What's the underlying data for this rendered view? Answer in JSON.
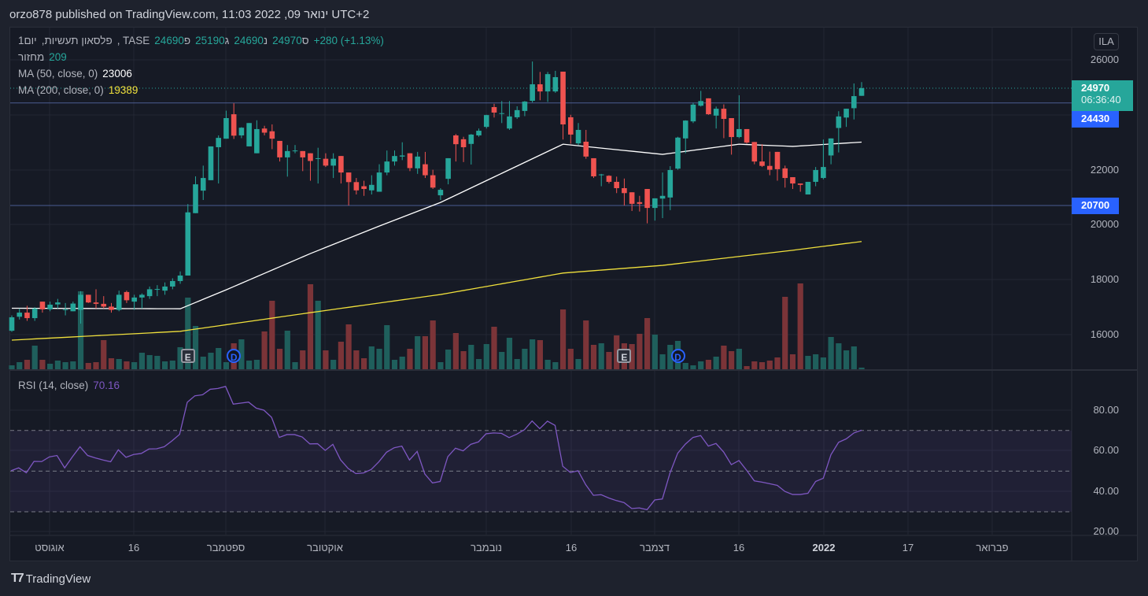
{
  "header": {
    "title": "orzo878 published on TradingView.com, ינואר 09, 2022 11:03 UTC+2"
  },
  "legend": {
    "interval": "1יום",
    "symbol": ",פלסאון תעשיות",
    "exchange": ", TASE",
    "open_label": "פ",
    "open": "24690",
    "high_label": "ג",
    "high": "25190",
    "low_label": "נ",
    "low": "24690",
    "close_label": "ס",
    "close": "24970",
    "change": "+280 (+1.13%)",
    "volume_label": "מחזור",
    "volume": "209",
    "ma50_label": "MA (50, close, 0)",
    "ma50": "23006",
    "ma200_label": "MA (200, close, 0)",
    "ma200": "19389",
    "rsi_label": "RSI (14, close)",
    "rsi": "70.16"
  },
  "price_scale": {
    "currency": "ILA",
    "ticks": [
      "26000",
      "22000",
      "20000",
      "18000",
      "16000"
    ],
    "last_price": "24970",
    "countdown": "06:36:40",
    "level_1": "24430",
    "level_2": "20700"
  },
  "rsi_scale": {
    "ticks": [
      "80.00",
      "60.00",
      "40.00",
      "20.00"
    ]
  },
  "time_axis": [
    "אוגוסט",
    "16",
    "ספטמבר",
    "אוקטובר",
    "נובמבר",
    "16",
    "דצמבר",
    "16",
    "2022",
    "17",
    "פברואר"
  ],
  "events": [
    {
      "type": "E",
      "index": 23
    },
    {
      "type": "D",
      "index": 29
    },
    {
      "type": "E",
      "index": 80
    },
    {
      "type": "D",
      "index": 87
    }
  ],
  "branding": "TradingView",
  "colors": {
    "up": "#26a69a",
    "down": "#ef5350",
    "ma50": "#ffffff",
    "ma200": "#f0e03c",
    "rsi": "#7e57c2",
    "level": "#2962ff"
  },
  "chart_data": {
    "type": "candlestick",
    "ylim": [
      15000,
      26500
    ],
    "horizontal_levels": [
      24430,
      20700
    ],
    "candles_ohlc": [
      [
        16140,
        16700,
        16100,
        16630
      ],
      [
        16650,
        16950,
        16550,
        16800
      ],
      [
        16800,
        17050,
        16500,
        16600
      ],
      [
        16600,
        17000,
        16500,
        16950
      ],
      [
        17200,
        17200,
        16800,
        16920
      ],
      [
        16920,
        17200,
        16850,
        17090
      ],
      [
        17100,
        17300,
        16950,
        17170
      ],
      [
        16900,
        17150,
        16700,
        16920
      ],
      [
        16850,
        17200,
        16850,
        17130
      ],
      [
        16900,
        17580,
        16400,
        17450
      ],
      [
        17450,
        17450,
        17150,
        17170
      ],
      [
        17170,
        17650,
        16950,
        17120
      ],
      [
        17120,
        17400,
        16950,
        17020
      ],
      [
        17020,
        17150,
        16800,
        16900
      ],
      [
        16900,
        17600,
        16850,
        17450
      ],
      [
        17550,
        17600,
        17150,
        17250
      ],
      [
        17200,
        17450,
        16900,
        17350
      ],
      [
        17350,
        17500,
        16950,
        17450
      ],
      [
        17400,
        17750,
        17300,
        17650
      ],
      [
        17650,
        17800,
        17400,
        17660
      ],
      [
        17600,
        17900,
        17450,
        17750
      ],
      [
        17750,
        18050,
        17650,
        17950
      ],
      [
        17950,
        18300,
        17850,
        18150
      ],
      [
        18150,
        20750,
        18150,
        20450
      ],
      [
        20420,
        21760,
        20420,
        21470
      ],
      [
        21240,
        22150,
        20900,
        21700
      ],
      [
        21620,
        22850,
        21620,
        22850
      ],
      [
        22820,
        23250,
        21500,
        23160
      ],
      [
        23130,
        24150,
        23130,
        23880
      ],
      [
        24020,
        24420,
        23120,
        23240
      ],
      [
        23250,
        23550,
        23150,
        23530
      ],
      [
        22850,
        23700,
        22850,
        23700
      ],
      [
        22600,
        23800,
        22600,
        23480
      ],
      [
        23500,
        23600,
        23250,
        23350
      ],
      [
        23400,
        23650,
        22750,
        23130
      ],
      [
        23050,
        23050,
        22300,
        22450
      ],
      [
        22450,
        22900,
        21750,
        22680
      ],
      [
        22680,
        22900,
        22600,
        22700
      ],
      [
        22680,
        22680,
        21950,
        22450
      ],
      [
        22600,
        22600,
        21600,
        22320
      ],
      [
        22400,
        22800,
        21500,
        22420
      ],
      [
        22400,
        22600,
        22100,
        22150
      ],
      [
        22150,
        22600,
        21700,
        22400
      ],
      [
        22500,
        22500,
        21500,
        21900
      ],
      [
        21900,
        21900,
        20700,
        21550
      ],
      [
        21550,
        21700,
        21100,
        21250
      ],
      [
        21400,
        21600,
        21050,
        21300
      ],
      [
        21250,
        21800,
        21100,
        21450
      ],
      [
        21200,
        22200,
        21200,
        21900
      ],
      [
        21900,
        22700,
        21800,
        22300
      ],
      [
        22300,
        22700,
        22150,
        22500
      ],
      [
        22480,
        23000,
        22350,
        22520
      ],
      [
        22600,
        22600,
        21950,
        22060
      ],
      [
        22050,
        22650,
        21850,
        22480
      ],
      [
        22200,
        22650,
        21700,
        21800
      ],
      [
        21800,
        22000,
        21300,
        21350
      ],
      [
        21070,
        21330,
        20900,
        21270
      ],
      [
        21670,
        22420,
        21470,
        22420
      ],
      [
        23250,
        23300,
        22300,
        22930
      ],
      [
        23110,
        23200,
        22280,
        22820
      ],
      [
        22940,
        23300,
        22190,
        23280
      ],
      [
        23250,
        23500,
        23200,
        23420
      ],
      [
        23560,
        24000,
        23500,
        23990
      ],
      [
        24280,
        24400,
        23900,
        24080
      ],
      [
        24050,
        24500,
        23700,
        24060
      ],
      [
        23500,
        24500,
        23450,
        23940
      ],
      [
        23910,
        24310,
        23850,
        24170
      ],
      [
        24140,
        24500,
        23950,
        24480
      ],
      [
        24510,
        25940,
        24450,
        25110
      ],
      [
        25110,
        25560,
        24530,
        24850
      ],
      [
        24850,
        25560,
        24470,
        25480
      ],
      [
        24850,
        25600,
        24800,
        25370
      ],
      [
        25570,
        25570,
        23100,
        23650
      ],
      [
        23910,
        24000,
        22950,
        23280
      ],
      [
        22960,
        23700,
        22900,
        23450
      ],
      [
        23020,
        23450,
        22400,
        22480
      ],
      [
        22420,
        22420,
        21700,
        21760
      ],
      [
        21800,
        21850,
        21400,
        21830
      ],
      [
        21780,
        21800,
        21500,
        21560
      ],
      [
        21560,
        21750,
        21150,
        21330
      ],
      [
        21330,
        21680,
        20700,
        21150
      ],
      [
        21180,
        21180,
        20500,
        20760
      ],
      [
        20820,
        21050,
        20480,
        20760
      ],
      [
        21300,
        21300,
        20050,
        20610
      ],
      [
        20610,
        20960,
        20150,
        20960
      ],
      [
        20950,
        21900,
        20240,
        21050
      ],
      [
        20990,
        22130,
        20530,
        21990
      ],
      [
        22040,
        23200,
        22000,
        23170
      ],
      [
        23140,
        23800,
        22600,
        23790
      ],
      [
        23760,
        24440,
        23700,
        24370
      ],
      [
        24330,
        24870,
        24300,
        24500
      ],
      [
        24600,
        24600,
        24000,
        24020
      ],
      [
        23970,
        24300,
        23500,
        24220
      ],
      [
        24220,
        24380,
        23150,
        23850
      ],
      [
        23880,
        23880,
        22550,
        23190
      ],
      [
        23190,
        24710,
        23150,
        23480
      ],
      [
        23480,
        23480,
        22950,
        22990
      ],
      [
        23010,
        23010,
        22200,
        22300
      ],
      [
        22300,
        22930,
        22100,
        22140
      ],
      [
        22140,
        22660,
        21800,
        22000
      ],
      [
        22650,
        22650,
        21600,
        22020
      ],
      [
        22050,
        22150,
        21350,
        21700
      ],
      [
        21730,
        21730,
        21300,
        21500
      ],
      [
        21500,
        21500,
        21200,
        21450
      ],
      [
        21100,
        21560,
        21100,
        21560
      ],
      [
        21560,
        22100,
        21400,
        21990
      ],
      [
        21700,
        23100,
        21650,
        22100
      ],
      [
        22520,
        23140,
        22200,
        23140
      ],
      [
        23520,
        24130,
        22630,
        23940
      ],
      [
        23900,
        24220,
        23560,
        24220
      ],
      [
        24240,
        25140,
        23830,
        24680
      ],
      [
        24690,
        25190,
        24690,
        24970
      ]
    ],
    "volume": [
      500,
      900,
      1200,
      3000,
      1200,
      700,
      1100,
      900,
      1000,
      9900,
      800,
      900,
      3700,
      1400,
      1300,
      1000,
      900,
      2100,
      1800,
      1700,
      1000,
      1100,
      2800,
      9100,
      5500,
      1600,
      2100,
      2700,
      900,
      3300,
      3800,
      1100,
      1200,
      4800,
      8700,
      2600,
      4900,
      900,
      2400,
      10800,
      8700,
      2400,
      1200,
      3500,
      5700,
      2400,
      1400,
      2900,
      2600,
      5600,
      1200,
      1600,
      2600,
      4200,
      4200,
      6200,
      900,
      2500,
      4600,
      2300,
      3100,
      1300,
      3200,
      5400,
      2200,
      4000,
      1300,
      2600,
      3800,
      3700,
      1200,
      900,
      7600,
      2600,
      1300,
      6200,
      3100,
      3300,
      2200,
      4300,
      3300,
      3200,
      4500,
      6500,
      4400,
      1900,
      3100,
      3600,
      800,
      500,
      1000,
      1200,
      1600,
      3000,
      2300,
      2600,
      400,
      1000,
      900,
      1100,
      1500,
      9200,
      1900,
      10900,
      1700,
      1900,
      1500,
      4100,
      3300,
      2400,
      2900,
      209
    ],
    "ma50_points": [
      [
        0,
        16960
      ],
      [
        22,
        16940
      ],
      [
        28,
        17630
      ],
      [
        39,
        18950
      ],
      [
        48,
        19950
      ],
      [
        56,
        20810
      ],
      [
        64,
        21870
      ],
      [
        72,
        22930
      ],
      [
        85,
        22560
      ],
      [
        95,
        22930
      ],
      [
        102,
        22850
      ],
      [
        111,
        23006
      ]
    ],
    "ma200_points": [
      [
        0,
        15800
      ],
      [
        22,
        16120
      ],
      [
        39,
        16800
      ],
      [
        56,
        17460
      ],
      [
        72,
        18240
      ],
      [
        85,
        18520
      ],
      [
        102,
        19070
      ],
      [
        111,
        19389
      ]
    ],
    "rsi": {
      "ylim": [
        20,
        90
      ],
      "overbought": 70,
      "middle": 50,
      "oversold": 30,
      "values": [
        50.2,
        51.6,
        49.2,
        54.8,
        54.7,
        57,
        57.7,
        51.6,
        57,
        62,
        57.7,
        56.5,
        55.5,
        54.6,
        60.5,
        56.8,
        58.2,
        58.7,
        60.9,
        61,
        62,
        64.9,
        68.1,
        83.9,
        87.1,
        87.6,
        90.3,
        90.7,
        91.7,
        83,
        83.5,
        84,
        81,
        80,
        76.5,
        66.6,
        68,
        68,
        66.8,
        63.4,
        63.5,
        60.2,
        63.2,
        55.6,
        51.3,
        48.8,
        49.1,
        50.8,
        54.6,
        59.3,
        61.5,
        62.3,
        55.5,
        59.7,
        48.6,
        44.2,
        44.9,
        57.1,
        61.3,
        60,
        63.2,
        64.4,
        68.4,
        68.8,
        68.6,
        66.5,
        68.2,
        70.4,
        74.7,
        70.9,
        74.6,
        72.5,
        52.4,
        49.3,
        50.2,
        43.3,
        38.1,
        38.4,
        36.8,
        35.5,
        34.5,
        31.6,
        31.9,
        31,
        35.8,
        36.3,
        49.1,
        58.8,
        63.3,
        66.6,
        67.5,
        62.3,
        63.6,
        59.4,
        53.2,
        55.2,
        50.4,
        45.2,
        44.6,
        43.8,
        43,
        40,
        38.5,
        38.5,
        39.1,
        44.9,
        46.5,
        58.1,
        64.2,
        65.9,
        68.8,
        70.16
      ]
    }
  }
}
